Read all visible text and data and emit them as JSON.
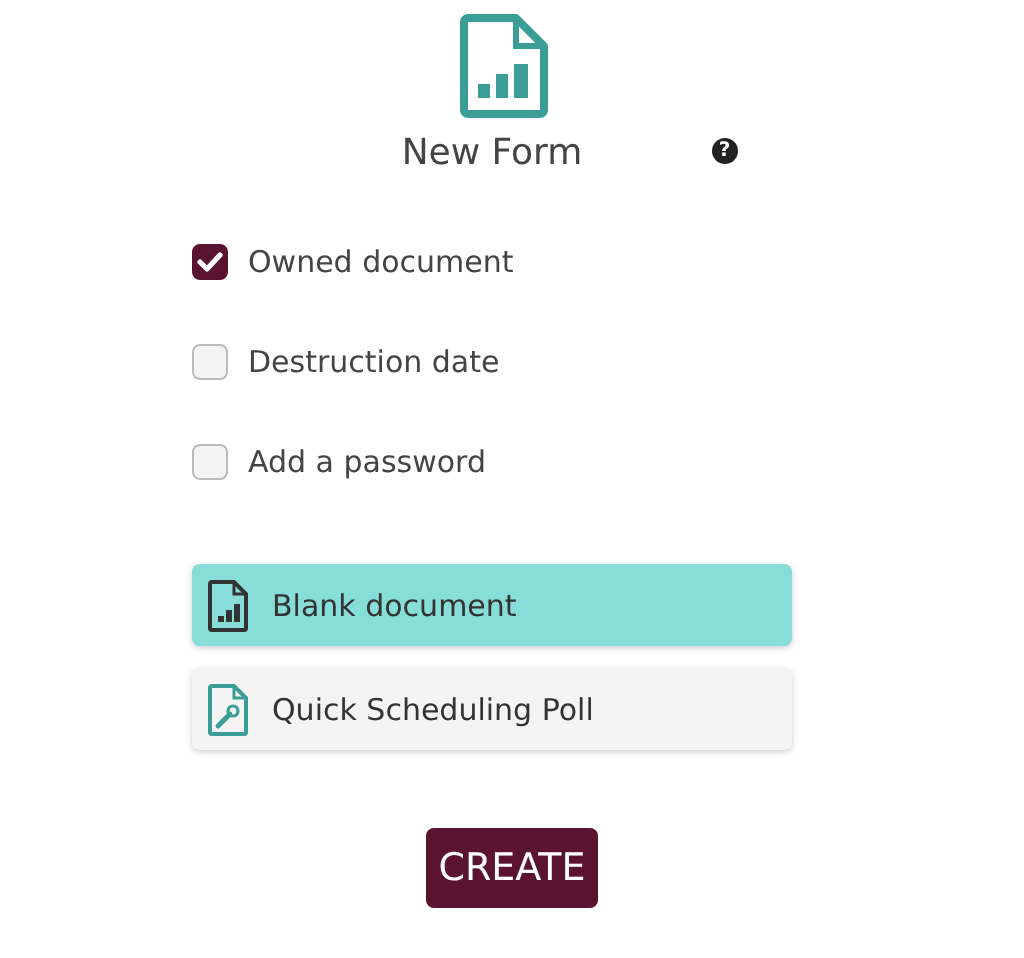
{
  "title": "New Form",
  "help_icon": "?",
  "options": [
    {
      "label": "Owned document",
      "checked": true
    },
    {
      "label": "Destruction date",
      "checked": false
    },
    {
      "label": "Add a password",
      "checked": false
    }
  ],
  "templates": [
    {
      "label": "Blank document",
      "kind": "chart",
      "selected": true
    },
    {
      "label": "Quick Scheduling Poll",
      "kind": "wrench",
      "selected": false
    }
  ],
  "create_button": "CREATE"
}
